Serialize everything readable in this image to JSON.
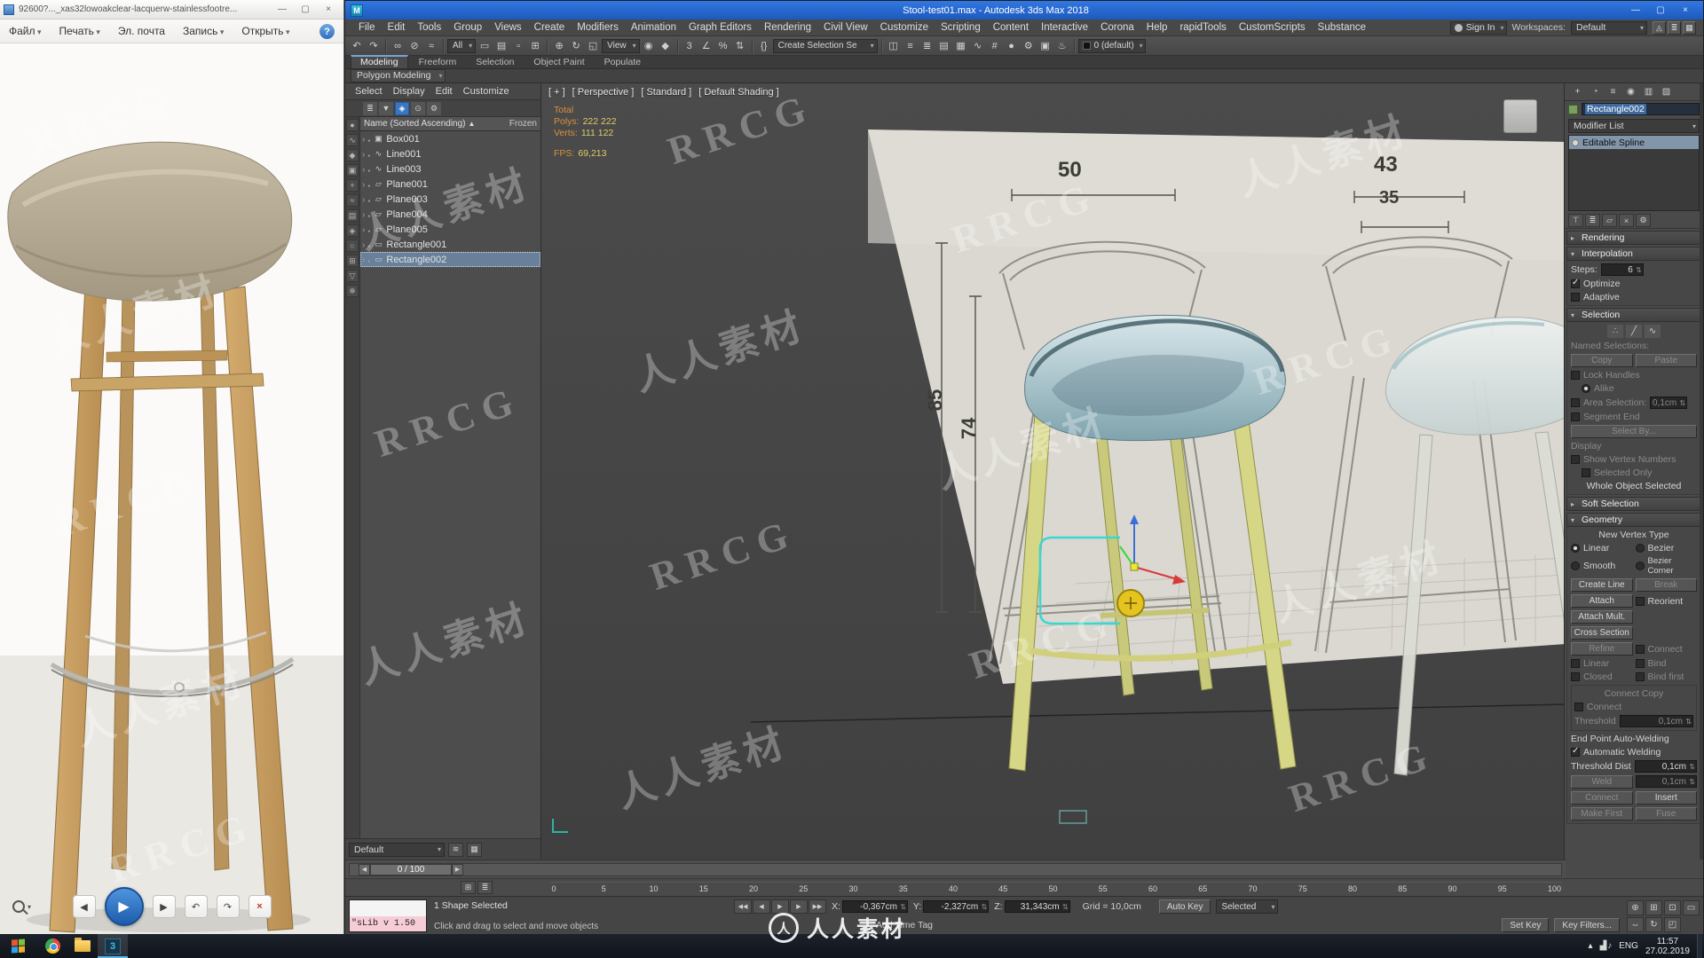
{
  "watermark": {
    "rrcg": "RRCG",
    "brand": "人人素材",
    "logo_char": "人"
  },
  "icons": {
    "minimize": "—",
    "maximize": "▢",
    "close": "×",
    "help": "?",
    "sort_asc": "▲",
    "play": "▶",
    "prev": "◀",
    "next": "▶",
    "rot_ccw": "↶",
    "rot_cw": "↷",
    "del": "×"
  },
  "photo_viewer": {
    "title": "92600?..._xas32lowoakclear-lacquerw-stainlessfootre...",
    "menus": [
      {
        "label": "Файл",
        "caret": true
      },
      {
        "label": "Печать",
        "caret": true
      },
      {
        "label": "Эл. почта",
        "caret": false
      },
      {
        "label": "Запись",
        "caret": true
      },
      {
        "label": "Открыть",
        "caret": true
      }
    ]
  },
  "max": {
    "logo": "M",
    "title": "Stool-test01.max - Autodesk 3ds Max 2018",
    "sign_in": "Sign In",
    "workspaces_label": "Workspaces:",
    "workspace": "Default",
    "menus": [
      "File",
      "Edit",
      "Tools",
      "Group",
      "Views",
      "Create",
      "Modifiers",
      "Animation",
      "Graph Editors",
      "Rendering",
      "Civil View",
      "Customize",
      "Scripting",
      "Content",
      "Interactive",
      "Corona",
      "Help",
      "rapidTools",
      "CustomScripts",
      "Substance"
    ],
    "ribbon_tabs": [
      {
        "label": "Modeling",
        "active": true
      },
      {
        "label": "Freeform",
        "active": false
      },
      {
        "label": "Selection",
        "active": false
      },
      {
        "label": "Object Paint",
        "active": false
      },
      {
        "label": "Populate",
        "active": false
      }
    ],
    "ribbon_subtab": "Polygon Modeling"
  },
  "toolbar": {
    "undo": [
      {
        "n": "undo-icon",
        "g": "↶"
      },
      {
        "n": "redo-icon",
        "g": "↷"
      }
    ],
    "link": [
      {
        "n": "select-and-link-icon",
        "g": "∞"
      },
      {
        "n": "unlink-selection-icon",
        "g": "⊘"
      },
      {
        "n": "bind-to-spacewarp-icon",
        "g": "≈"
      }
    ],
    "filter_dd": "All",
    "select": [
      {
        "n": "select-object-icon",
        "g": "▭"
      },
      {
        "n": "select-by-name-icon",
        "g": "▤"
      },
      {
        "n": "rect-selection-region-icon",
        "g": "▫"
      },
      {
        "n": "window-crossing-icon",
        "g": "⊞"
      }
    ],
    "transform": [
      {
        "n": "select-and-move-icon",
        "g": "⊕"
      },
      {
        "n": "select-and-rotate-icon",
        "g": "↻"
      },
      {
        "n": "select-and-scale-icon",
        "g": "◱"
      }
    ],
    "ref_dd": "View",
    "pivot": [
      {
        "n": "use-pivot-center-icon",
        "g": "◉"
      },
      {
        "n": "select-and-manipulate-icon",
        "g": "◆"
      }
    ],
    "snaps": [
      {
        "n": "snaps-toggle-icon",
        "g": "3"
      },
      {
        "n": "angle-snap-icon",
        "g": "∠"
      },
      {
        "n": "percent-snap-icon",
        "g": "%"
      },
      {
        "n": "spinner-snap-icon",
        "g": "⇅"
      }
    ],
    "named": [
      {
        "n": "edit-named-selection-sets-icon",
        "g": "{}"
      }
    ],
    "sel_dd": "Create Selection Se",
    "tools": [
      {
        "n": "mirror-icon",
        "g": "◫"
      },
      {
        "n": "align-icon",
        "g": "≡"
      },
      {
        "n": "toggle-scene-explorer-icon",
        "g": "≣"
      },
      {
        "n": "toggle-layer-explorer-icon",
        "g": "▤"
      },
      {
        "n": "toggle-ribbon-icon",
        "g": "▦"
      },
      {
        "n": "curve-editor-icon",
        "g": "∿"
      },
      {
        "n": "schematic-view-icon",
        "g": "#"
      },
      {
        "n": "material-editor-icon",
        "g": "●"
      },
      {
        "n": "render-setup-icon",
        "g": "⚙"
      },
      {
        "n": "rendered-frame-icon",
        "g": "▣"
      },
      {
        "n": "render-production-icon",
        "g": "♨"
      }
    ],
    "default_field": "0 (default)",
    "end": [
      {
        "n": "isolate-selection-icon",
        "g": "◬"
      },
      {
        "n": "display-layers-icon",
        "g": "≣"
      },
      {
        "n": "grid-toggle-icon",
        "g": "▦"
      }
    ]
  },
  "explorer": {
    "menus": [
      "Select",
      "Display",
      "Edit",
      "Customize"
    ],
    "tools": [
      {
        "n": "explorer-list-icon",
        "g": "≣",
        "hl": false
      },
      {
        "n": "explorer-sort-icon",
        "g": "▼",
        "hl": false
      },
      {
        "n": "explorer-filter-icon",
        "g": "◈",
        "hl": true
      },
      {
        "n": "explorer-lock-icon",
        "g": "⊙",
        "hl": false
      },
      {
        "n": "explorer-settings-icon",
        "g": "⚙",
        "hl": false
      }
    ],
    "name_col": "Name (Sorted Ascending)",
    "frozen_col": "Frozen",
    "items": [
      {
        "name": "Box001",
        "icon": "▣",
        "selected": false
      },
      {
        "name": "Line001",
        "icon": "∿",
        "selected": false
      },
      {
        "name": "Line003",
        "icon": "∿",
        "selected": false
      },
      {
        "name": "Plane001",
        "icon": "▱",
        "selected": false
      },
      {
        "name": "Plane003",
        "icon": "▱",
        "selected": false
      },
      {
        "name": "Plane004",
        "icon": "▱",
        "selected": false
      },
      {
        "name": "Plane005",
        "icon": "▱",
        "selected": false
      },
      {
        "name": "Rectangle001",
        "icon": "▭",
        "selected": false
      },
      {
        "name": "Rectangle002",
        "icon": "▭",
        "selected": true
      }
    ],
    "strip": [
      {
        "n": "strip-geometry-icon",
        "g": "●"
      },
      {
        "n": "strip-shapes-icon",
        "g": "∿"
      },
      {
        "n": "strip-lights-icon",
        "g": "◆"
      },
      {
        "n": "strip-cameras-icon",
        "g": "▣"
      },
      {
        "n": "strip-helpers-icon",
        "g": "+"
      },
      {
        "n": "strip-spacewarps-icon",
        "g": "≈"
      },
      {
        "n": "strip-groups-icon",
        "g": "▤"
      },
      {
        "n": "strip-xrefs-icon",
        "g": "◈"
      },
      {
        "n": "strip-bones-icon",
        "g": "○"
      },
      {
        "n": "strip-containers-icon",
        "g": "⊞"
      },
      {
        "n": "strip-materials-icon",
        "g": "▽"
      },
      {
        "n": "strip-frozen-icon",
        "g": "❄"
      }
    ],
    "bottom_dd": "Default"
  },
  "viewport": {
    "plus": "[ + ]",
    "pov": "[ Perspective ]",
    "standard": "[ Standard ]",
    "shading": "[ Default Shading ]",
    "stats": {
      "total": "Total",
      "polys_label": "Polys:",
      "polys": "222 222",
      "verts_label": "Verts:",
      "verts": "111 122",
      "fps_label": "FPS:",
      "fps": "69,213"
    },
    "dims": {
      "d50": "50",
      "d43": "43",
      "d35": "35",
      "d85": "85",
      "d74": "74"
    }
  },
  "panel": {
    "tabs": [
      {
        "n": "create-tab-icon",
        "g": "+"
      },
      {
        "n": "modify-tab-icon",
        "g": "◔"
      },
      {
        "n": "hierarchy-tab-icon",
        "g": "≡"
      },
      {
        "n": "motion-tab-icon",
        "g": "◉"
      },
      {
        "n": "display-tab-icon",
        "g": "▥"
      },
      {
        "n": "utilities-tab-icon",
        "g": "▨"
      }
    ],
    "object_name": "Rectangle002",
    "modifier_list": "Modifier List",
    "stack": [
      {
        "label": "Editable Spline",
        "selected": true
      }
    ],
    "stack_tools": [
      {
        "n": "pin-stack-icon",
        "g": "⊤"
      },
      {
        "n": "show-end-result-icon",
        "g": "≣"
      },
      {
        "n": "make-unique-icon",
        "g": "▱"
      },
      {
        "n": "remove-modifier-icon",
        "g": "×"
      },
      {
        "n": "configure-modifier-icon",
        "g": "⚙"
      }
    ],
    "rendering": "Rendering",
    "interpolation": "Interpolation",
    "steps_label": "Steps:",
    "steps": "6",
    "optimize": "Optimize",
    "adaptive": "Adaptive",
    "selection": "Selection",
    "sub_icons": [
      {
        "n": "vertex-subobject-icon",
        "g": "∴"
      },
      {
        "n": "segment-subobject-icon",
        "g": "╱"
      },
      {
        "n": "spline-subobject-icon",
        "g": "∿"
      }
    ],
    "named_sel": "Named Selections:",
    "copy": "Copy",
    "paste": "Paste",
    "lock_handles": "Lock Handles",
    "alike": "Alike",
    "area_selection": "Area Selection:",
    "area_value": "0,1cm",
    "segment_end": "Segment End",
    "select_by": "Select By...",
    "display": "Display",
    "show_vertex_numbers": "Show Vertex Numbers",
    "selected_only": "Selected Only",
    "status": "Whole Object Selected",
    "soft_selection": "Soft Selection",
    "geometry": "Geometry",
    "new_vertex_type": "New Vertex Type",
    "linear": "Linear",
    "bezier": "Bezier",
    "smooth": "Smooth",
    "bezier_corner": "Bezier Corner",
    "create_line": "Create Line",
    "break_btn": "Break",
    "attach": "Attach",
    "reorient": "Reorient",
    "attach_mult": "Attach Mult.",
    "cross_section": "Cross Section",
    "refine": "Refine",
    "connect_chk": "Connect",
    "linear_chk": "Linear",
    "bind": "Bind",
    "closed": "Closed",
    "bind_first": "Bind first",
    "connect_copy": "Connect Copy",
    "connect2": "Connect",
    "threshold": "Threshold",
    "threshold_value": "0,1cm",
    "end_point": "End Point Auto-Welding",
    "auto_weld": "Automatic Welding",
    "threshold_dist": "Threshold Dist",
    "threshold_dist_value": "0,1cm",
    "weld": "Weld",
    "weld_value": "0,1cm",
    "connect_btn": "Connect",
    "insert": "Insert",
    "make_first": "Make First",
    "fuse": "Fuse"
  },
  "timeline": {
    "handle": "0 / 100",
    "ticks": [
      "0",
      "5",
      "10",
      "15",
      "20",
      "25",
      "30",
      "35",
      "40",
      "45",
      "50",
      "55",
      "60",
      "65",
      "70",
      "75",
      "80",
      "85",
      "90",
      "95",
      "100"
    ]
  },
  "status": {
    "listener": "\"sLib v 1.50",
    "selected_info": "1 Shape Selected",
    "hint": "Click and drag to select and move objects",
    "playback": [
      {
        "n": "go-to-start-icon",
        "g": "◀◀"
      },
      {
        "n": "previous-frame-icon",
        "g": "◀"
      },
      {
        "n": "play-animation-icon",
        "g": "▶"
      },
      {
        "n": "next-frame-icon",
        "g": "▶"
      },
      {
        "n": "go-to-end-icon",
        "g": "▶▶"
      }
    ],
    "x_label": "X:",
    "x": "-0,367cm",
    "y_label": "Y:",
    "y": "-2,327cm",
    "z_label": "Z:",
    "z": "31,343cm",
    "grid": "Grid = 10,0cm",
    "add_time_tag": "Add Time Tag",
    "auto_key": "Auto Key",
    "selected_dd": "Selected",
    "set_key": "Set Key",
    "key_filters": "Key Filters...",
    "nav": [
      {
        "n": "zoom-icon",
        "g": "⊕"
      },
      {
        "n": "zoom-all-icon",
        "g": "⊞"
      },
      {
        "n": "zoom-extents-icon",
        "g": "⊡"
      },
      {
        "n": "zoom-region-icon",
        "g": "▭"
      },
      {
        "n": "pan-icon",
        "g": "⇔"
      },
      {
        "n": "orbit-icon",
        "g": "↻"
      },
      {
        "n": "maximize-viewport-icon",
        "g": "◰"
      }
    ]
  },
  "taskbar": {
    "max_glyph": "3",
    "tray_up": "▴",
    "tray_icons": [
      {
        "n": "network-icon",
        "g": "▟"
      },
      {
        "n": "volume-icon",
        "g": "♪"
      }
    ],
    "lang": "ENG",
    "time": "11:57",
    "date": "27.02.2019"
  }
}
